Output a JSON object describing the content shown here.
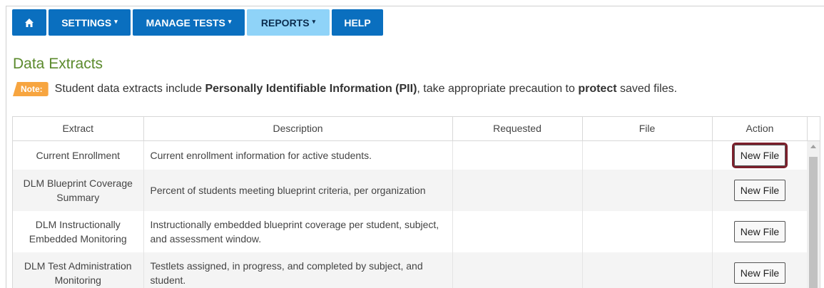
{
  "nav": {
    "home_icon": "home-icon",
    "items": [
      {
        "label": "SETTINGS",
        "has_caret": true
      },
      {
        "label": "MANAGE TESTS",
        "has_caret": true
      },
      {
        "label": "REPORTS",
        "has_caret": true
      },
      {
        "label": "HELP",
        "has_caret": false
      }
    ],
    "caret": "▾"
  },
  "page": {
    "title": "Data Extracts",
    "note_badge": "Note:",
    "note_text_1": "Student data extracts include ",
    "note_bold_1": "Personally Identifiable Information (PII)",
    "note_text_2": ", take appropriate precaution to ",
    "note_bold_2": "protect",
    "note_text_3": " saved files."
  },
  "table": {
    "headers": {
      "extract": "Extract",
      "description": "Description",
      "requested": "Requested",
      "file": "File",
      "action": "Action"
    },
    "rows": [
      {
        "extract": "Current Enrollment",
        "description": "Current enrollment information for active students.",
        "requested": "",
        "file": "",
        "action": "New File"
      },
      {
        "extract": "DLM Blueprint Coverage Summary",
        "description": "Percent of students meeting blueprint criteria, per organization",
        "requested": "",
        "file": "",
        "action": "New File"
      },
      {
        "extract": "DLM Instructionally Embedded Monitoring",
        "description": "Instructionally embedded blueprint coverage per student, subject, and assessment window.",
        "requested": "",
        "file": "",
        "action": "New File"
      },
      {
        "extract": "DLM Test Administration Monitoring",
        "description": "Testlets assigned, in progress, and completed by subject, and student.",
        "requested": "",
        "file": "",
        "action": "New File"
      }
    ]
  },
  "colors": {
    "nav_blue": "#0a6fbf",
    "nav_active": "#8fd3f8",
    "title_green": "#5b8a2c",
    "note_orange": "#f7a540",
    "focus_outline": "#7b1f2b"
  }
}
